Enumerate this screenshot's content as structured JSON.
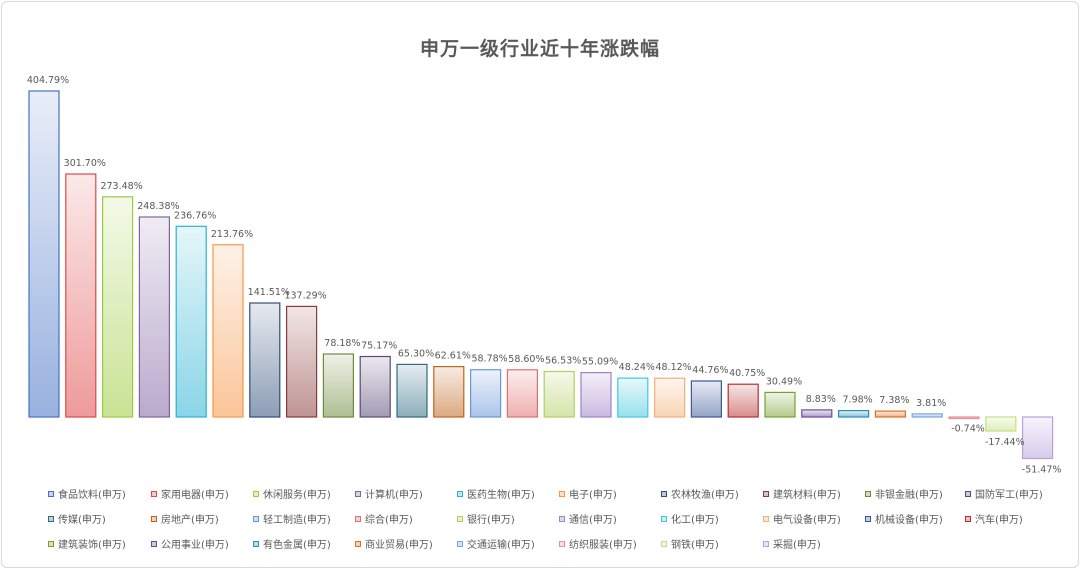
{
  "chart_data": {
    "type": "bar",
    "title": "申万一级行业近十年涨跌幅",
    "xlabel": "",
    "ylabel": "",
    "ylim": [
      -60,
      420
    ],
    "grid": false,
    "legend_position": "bottom",
    "series": [
      {
        "name": "食品饮料(申万)",
        "value": 404.79,
        "label": "404.79%",
        "color": "#4472c4"
      },
      {
        "name": "家用电器(申万)",
        "value": 301.7,
        "label": "301.70%",
        "color": "#e04848"
      },
      {
        "name": "休闲服务(申万)",
        "value": 273.48,
        "label": "273.48%",
        "color": "#9ccc3c"
      },
      {
        "name": "计算机(申万)",
        "value": 248.38,
        "label": "248.38%",
        "color": "#8064a2"
      },
      {
        "name": "医药生物(申万)",
        "value": 236.76,
        "label": "236.76%",
        "color": "#2ab3d4"
      },
      {
        "name": "电子(申万)",
        "value": 213.76,
        "label": "213.76%",
        "color": "#f79646"
      },
      {
        "name": "农林牧渔(申万)",
        "value": 141.51,
        "label": "141.51%",
        "color": "#2f4d7a"
      },
      {
        "name": "建筑材料(申万)",
        "value": 137.29,
        "label": "137.29%",
        "color": "#8b3a3a"
      },
      {
        "name": "非银金融(申万)",
        "value": 78.18,
        "label": "78.18%",
        "color": "#6e8a3a"
      },
      {
        "name": "国防军工(申万)",
        "value": 75.17,
        "label": "75.17%",
        "color": "#5a4a78"
      },
      {
        "name": "传媒(申万)",
        "value": 65.3,
        "label": "65.30%",
        "color": "#2e6b82"
      },
      {
        "name": "房地产(申万)",
        "value": 62.61,
        "label": "62.61%",
        "color": "#c0641c"
      },
      {
        "name": "轻工制造(申万)",
        "value": 58.78,
        "label": "58.78%",
        "color": "#6a96d8"
      },
      {
        "name": "综合(申万)",
        "value": 58.6,
        "label": "58.60%",
        "color": "#e07070"
      },
      {
        "name": "银行(申万)",
        "value": 56.53,
        "label": "56.53%",
        "color": "#b0d060"
      },
      {
        "name": "通信(申万)",
        "value": 55.09,
        "label": "55.09%",
        "color": "#a080c8"
      },
      {
        "name": "化工(申万)",
        "value": 48.24,
        "label": "48.24%",
        "color": "#40c8e0"
      },
      {
        "name": "电气设备(申万)",
        "value": 48.12,
        "label": "48.12%",
        "color": "#f4b078"
      },
      {
        "name": "机械设备(申万)",
        "value": 44.76,
        "label": "44.76%",
        "color": "#3a5a9a"
      },
      {
        "name": "汽车(申万)",
        "value": 40.75,
        "label": "40.75%",
        "color": "#b83030"
      },
      {
        "name": "建筑装饰(申万)",
        "value": 30.49,
        "label": "30.49%",
        "color": "#7aa030"
      },
      {
        "name": "公用事业(申万)",
        "value": 8.83,
        "label": "8.83%",
        "color": "#6a4a9a"
      },
      {
        "name": "有色金属(申万)",
        "value": 7.98,
        "label": "7.98%",
        "color": "#2890b8"
      },
      {
        "name": "商业贸易(申万)",
        "value": 7.38,
        "label": "7.38%",
        "color": "#e07020"
      },
      {
        "name": "交通运输(申万)",
        "value": 3.81,
        "label": "3.81%",
        "color": "#7aa6dc"
      },
      {
        "name": "纺织服装(申万)",
        "value": -0.74,
        "label": "-0.74%",
        "color": "#e89090"
      },
      {
        "name": "钢铁(申万)",
        "value": -17.44,
        "label": "-17.44%",
        "color": "#c4e080"
      },
      {
        "name": "采掘(申万)",
        "value": -51.47,
        "label": "-51.47%",
        "color": "#b8a0dc"
      }
    ]
  }
}
